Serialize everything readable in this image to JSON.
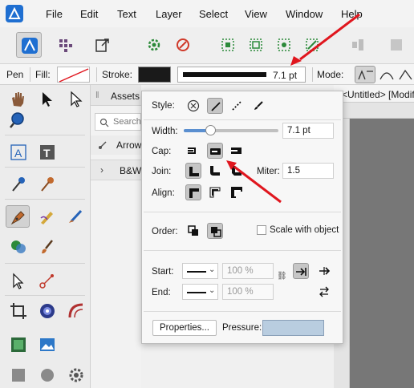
{
  "menu": [
    "File",
    "Edit",
    "Text",
    "Layer",
    "Select",
    "View",
    "Window",
    "Help"
  ],
  "context": {
    "tool_name": "Pen",
    "fill_label": "Fill:",
    "stroke_label": "Stroke:",
    "stroke_width_value": "7.1 pt",
    "mode_label": "Mode:"
  },
  "assets": {
    "tab_label": "Assets",
    "search_placeholder": "Search",
    "arrow_item": "Arrow",
    "group_item": "B&W"
  },
  "document_tab": "<Untitled> [Modifi",
  "popup": {
    "style_label": "Style:",
    "width_label": "Width:",
    "width_value": "7.1 pt",
    "width_fraction": 0.28,
    "cap_label": "Cap:",
    "join_label": "Join:",
    "miter_label": "Miter:",
    "miter_value": "1.5",
    "align_label": "Align:",
    "order_label": "Order:",
    "scale_label": "Scale with object",
    "start_label": "Start:",
    "end_label": "End:",
    "start_scale": "100 %",
    "end_scale": "100 %",
    "properties_label": "Properties...",
    "pressure_label": "Pressure:"
  },
  "colors": {
    "accent": "#1f6fd1",
    "stroke_swatch": "#1a1a1a",
    "pressure_fill": "#b9cde0",
    "annotation_arrow": "#e0161e",
    "canvas": "#7a7a7a"
  }
}
